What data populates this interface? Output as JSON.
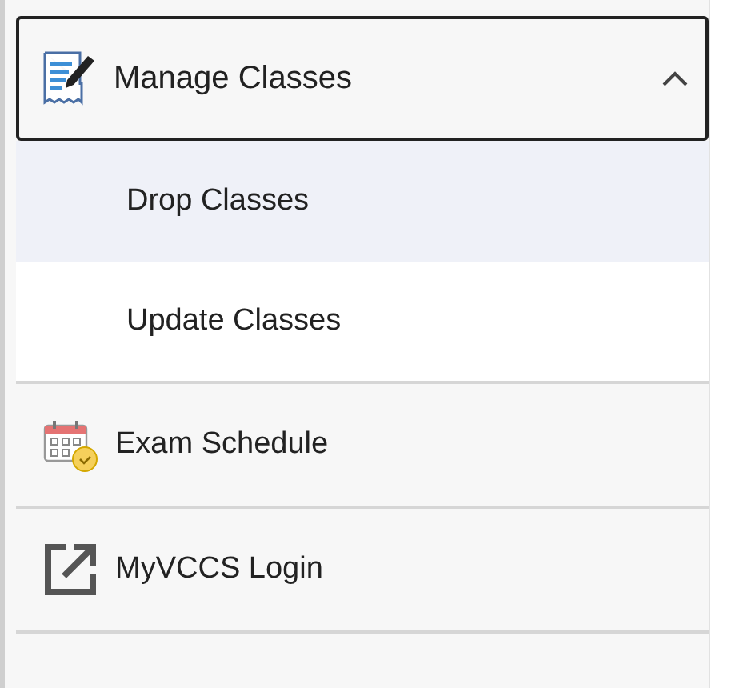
{
  "menu": {
    "title": "Manage Classes",
    "expanded": true,
    "children": [
      {
        "label": "Drop Classes",
        "selected": true
      },
      {
        "label": "Update Classes",
        "selected": false
      }
    ]
  },
  "items": [
    {
      "label": "Exam Schedule",
      "kind": "calendar"
    },
    {
      "label": "MyVCCS Login",
      "kind": "external"
    }
  ]
}
